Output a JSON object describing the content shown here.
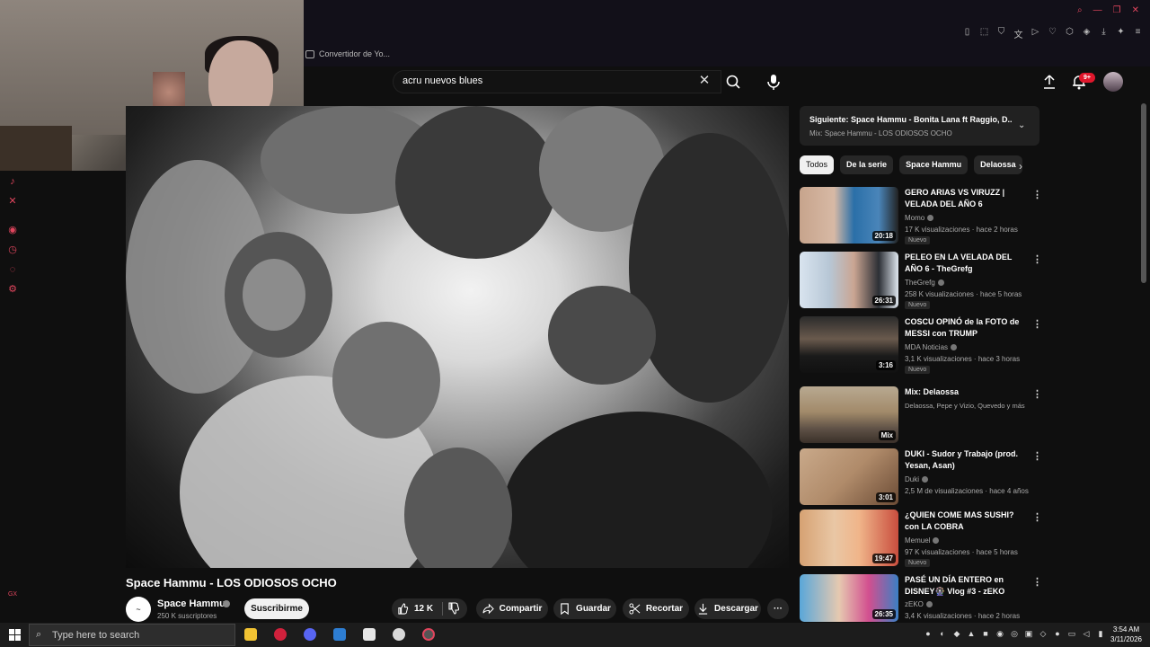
{
  "browser": {
    "tab_label": "Convertidor de Yo...",
    "accent": "#e0455d"
  },
  "search": {
    "value": "acru nuevos blues",
    "placeholder": "Buscar"
  },
  "header": {
    "notifications_badge": "9+"
  },
  "video": {
    "title": "Space Hammu - LOS ODIOSOS OCHO",
    "channel": "Space Hammu",
    "subscribers": "250 K suscriptores",
    "channel_avatar_glyph": "~",
    "subscribe_label": "Suscribirme",
    "likes": "12 K",
    "share_label": "Compartir",
    "save_label": "Guardar",
    "clip_label": "Recortar",
    "download_label": "Descargar"
  },
  "up_next": {
    "title": "Siguiente: Space Hammu - Bonita Lana ft Raggio, D...",
    "subtitle": "Mix: Space Hammu - LOS ODIOSOS OCHO"
  },
  "chips": [
    "Todos",
    "De la serie",
    "Space Hammu",
    "Delaossa"
  ],
  "recommendations": [
    {
      "title": "GERO ARIAS VS VIRUZZ | VELADA DEL AÑO 6",
      "channel": "Momo",
      "meta": "17 K visualizaciones · hace 2 horas",
      "badge": "Nuevo",
      "duration": "20:18"
    },
    {
      "title": "PELEO EN LA VELADA DEL AÑO 6 - TheGrefg",
      "channel": "TheGrefg",
      "meta": "258 K visualizaciones · hace 5 horas",
      "badge": "Nuevo",
      "duration": "26:31"
    },
    {
      "title": "COSCU OPINÓ de la FOTO de MESSI con TRUMP",
      "channel": "MDA Noticias",
      "meta": "3,1 K visualizaciones · hace 3 horas",
      "badge": "Nuevo",
      "duration": "3:16"
    },
    {
      "title": "Mix: Delaossa",
      "channel": "Delaossa, Pepe y Vizio, Quevedo y más",
      "meta": "",
      "badge": "",
      "duration": "Mix"
    },
    {
      "title": "DUKI - Sudor y Trabajo (prod. Yesan, Asan)",
      "channel": "Duki",
      "meta": "2,5 M de visualizaciones · hace 4 años",
      "badge": "",
      "duration": "3:01"
    },
    {
      "title": "¿QUIEN COME MAS SUSHI? con LA COBRA",
      "channel": "Memuel",
      "meta": "97 K visualizaciones · hace 5 horas",
      "badge": "Nuevo",
      "duration": "19:47"
    },
    {
      "title": "PASÉ UN DÍA ENTERO en DISNEY🎡 Vlog #3 - zEKO",
      "channel": "zEKO",
      "meta": "3,4 K visualizaciones · hace 2 horas",
      "badge": "",
      "duration": "26:35"
    }
  ],
  "taskbar": {
    "search_placeholder": "Type here to search",
    "time": "3:54 AM",
    "date": "3/11/2026"
  }
}
